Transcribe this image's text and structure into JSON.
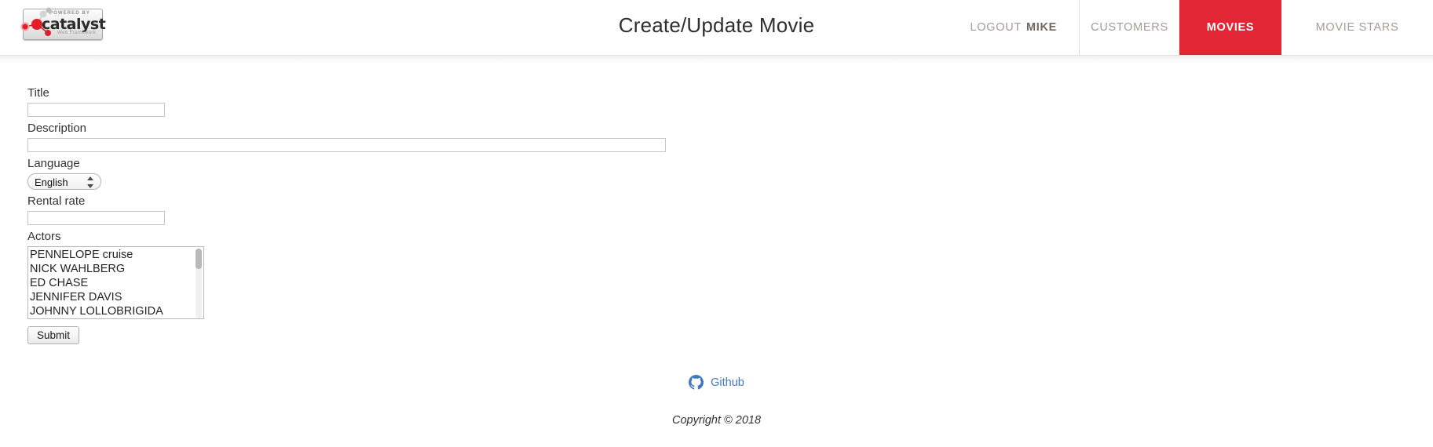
{
  "header": {
    "logo": {
      "powered_by": "POWERED BY",
      "name": "catalyst",
      "subtitle": "Web Framework"
    },
    "title": "Create/Update Movie",
    "nav": {
      "logout_prefix": "LOGOUT",
      "logout_user": "MIKE",
      "items": [
        {
          "label": "CUSTOMERS",
          "active": false
        },
        {
          "label": "MOVIES",
          "active": true
        },
        {
          "label": "MOVIE STARS",
          "active": false
        }
      ]
    }
  },
  "form": {
    "title": {
      "label": "Title",
      "value": "",
      "placeholder": ""
    },
    "description": {
      "label": "Description",
      "value": "",
      "placeholder": ""
    },
    "language": {
      "label": "Language",
      "selected": "English"
    },
    "rental_rate": {
      "label": "Rental rate",
      "value": "",
      "placeholder": ""
    },
    "actors": {
      "label": "Actors",
      "options": [
        "PENNELOPE cruise",
        "NICK WAHLBERG",
        "ED CHASE",
        "JENNIFER DAVIS",
        "JOHNNY LOLLOBRIGIDA"
      ]
    },
    "submit_label": "Submit"
  },
  "footer": {
    "github_label": "Github",
    "copyright": "Copyright © 2018"
  },
  "colors": {
    "accent_red": "#e32636",
    "link_blue": "#4078c0",
    "nav_text": "#a39b93"
  }
}
